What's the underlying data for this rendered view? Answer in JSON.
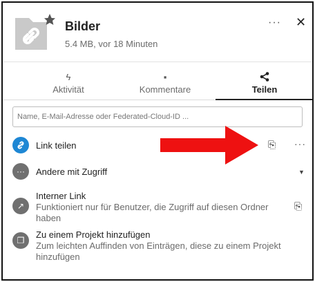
{
  "header": {
    "title": "Bilder",
    "subtitle": "5.4 MB, vor 18 Minuten",
    "more_label": "···",
    "close_label": "✕"
  },
  "tabs": [
    {
      "label": "Aktivität",
      "icon": "lightning-icon",
      "glyph": "ϟ"
    },
    {
      "label": "Kommentare",
      "icon": "comment-icon",
      "glyph": "▪"
    },
    {
      "label": "Teilen",
      "icon": "share-icon",
      "glyph": "<",
      "active": true
    }
  ],
  "search": {
    "placeholder": "Name, E-Mail-Adresse oder Federated-Cloud-ID ..."
  },
  "rows": {
    "link_share": {
      "title": "Link teilen",
      "icon": "link-icon",
      "clip": "⎘",
      "more": "···"
    },
    "others_access": {
      "title": "Andere mit Zugriff",
      "icon": "dots-icon",
      "glyph": "···",
      "caret": "▼"
    },
    "internal_link": {
      "title": "Interner Link",
      "subtitle": "Funktioniert nur für Benutzer, die Zugriff auf diesen Ordner haben",
      "icon": "external-link-icon",
      "glyph": "↗",
      "clip": "⎘"
    },
    "project": {
      "title": "Zu einem Projekt hinzufügen",
      "subtitle": "Zum leichten Auffinden von Einträgen, diese zu einem Projekt hinzufügen",
      "icon": "project-icon",
      "glyph": "❐"
    }
  },
  "colors": {
    "link_avatar": "#1e87d4",
    "grey_avatar": "#707070",
    "annotation_arrow": "#ee1111"
  }
}
